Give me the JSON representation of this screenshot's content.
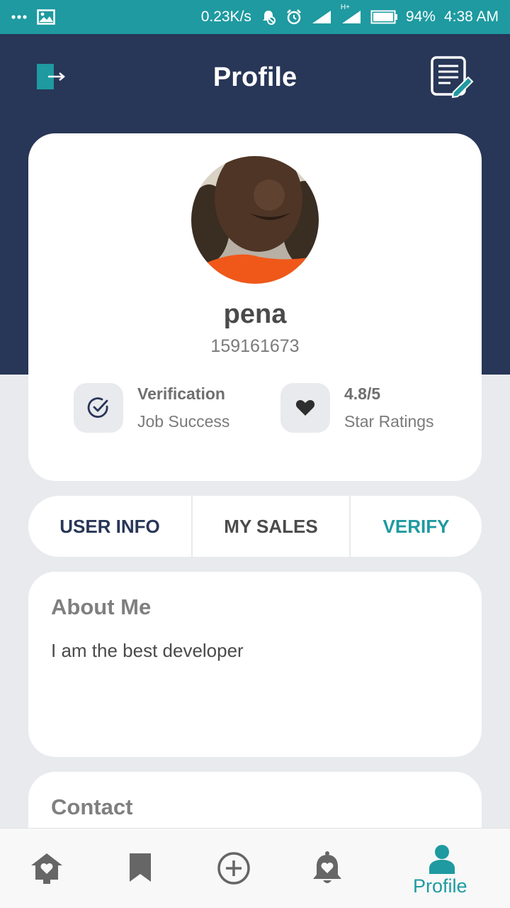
{
  "status_bar": {
    "network_speed": "0.23K/s",
    "network_type": "H+",
    "battery": "94%",
    "time": "4:38 AM"
  },
  "header": {
    "title": "Profile"
  },
  "profile": {
    "name": "pena",
    "id": "159161673",
    "stats": [
      {
        "title": "Verification",
        "subtitle": "Job Success",
        "icon": "check-circle-icon"
      },
      {
        "title": "4.8/5",
        "subtitle": "Star Ratings",
        "icon": "heart-icon"
      }
    ]
  },
  "tabs": [
    {
      "label": "USER INFO"
    },
    {
      "label": "MY SALES"
    },
    {
      "label": "VERIFY"
    }
  ],
  "about": {
    "heading": "About Me",
    "text": "I am the best developer"
  },
  "contact": {
    "heading": "Contact"
  },
  "bottom_nav": {
    "items": [
      {
        "icon": "home-icon"
      },
      {
        "icon": "bookmark-icon"
      },
      {
        "icon": "add-circle-icon"
      },
      {
        "icon": "notification-bell-icon"
      },
      {
        "icon": "profile-person-icon",
        "label": "Profile",
        "active": true
      }
    ]
  },
  "colors": {
    "status_bar": "#1e9aa0",
    "header": "#283657",
    "accent": "#1e9aa0",
    "background": "#e9eaee"
  }
}
